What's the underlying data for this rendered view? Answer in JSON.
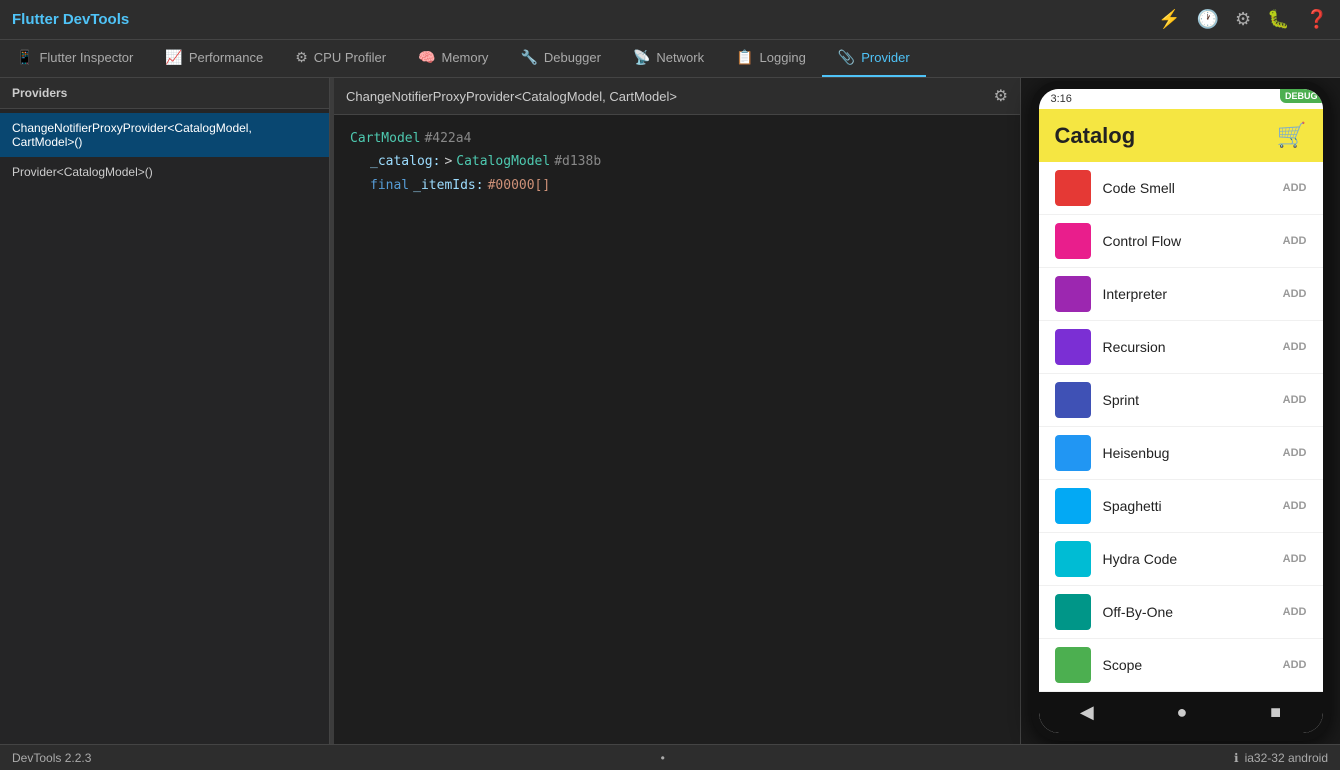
{
  "app": {
    "title": "Flutter DevTools"
  },
  "tabs": [
    {
      "id": "flutter-inspector",
      "label": "Flutter Inspector",
      "icon": "📱",
      "active": false
    },
    {
      "id": "performance",
      "label": "Performance",
      "icon": "📈",
      "active": false
    },
    {
      "id": "cpu-profiler",
      "label": "CPU Profiler",
      "icon": "⚙",
      "active": false
    },
    {
      "id": "memory",
      "label": "Memory",
      "icon": "🧠",
      "active": false
    },
    {
      "id": "debugger",
      "label": "Debugger",
      "icon": "🔧",
      "active": false
    },
    {
      "id": "network",
      "label": "Network",
      "icon": "📡",
      "active": false
    },
    {
      "id": "logging",
      "label": "Logging",
      "icon": "📋",
      "active": false
    },
    {
      "id": "provider",
      "label": "Provider",
      "icon": "📎",
      "active": true
    }
  ],
  "topbar_icons": {
    "lightning": "⚡",
    "history": "🕐",
    "settings": "⚙",
    "bug": "🐛",
    "help": "❓"
  },
  "providers_panel": {
    "header": "Providers",
    "items": [
      {
        "label": "ChangeNotifierProxyProvider<CatalogModel, CartModel>()",
        "selected": true
      },
      {
        "label": "Provider<CatalogModel>()",
        "selected": false
      }
    ]
  },
  "detail_panel": {
    "header": "ChangeNotifierProxyProvider<CatalogModel, CartModel>",
    "code": {
      "line1_ref": "CartModel",
      "line1_hash": "#422a4",
      "line2_key": "_catalog:",
      "line2_arrow": ">",
      "line2_type": "CatalogModel",
      "line2_hash": "#d138b",
      "line3_modifier": "final",
      "line3_key": "_itemIds:",
      "line3_value": "#00000[]"
    }
  },
  "phone": {
    "status_time": "3:16",
    "app_title": "Catalog",
    "items": [
      {
        "name": "Code Smell",
        "color": "#e53935",
        "add": "ADD"
      },
      {
        "name": "Control Flow",
        "color": "#e91e8c",
        "add": "ADD"
      },
      {
        "name": "Interpreter",
        "color": "#9c27b0",
        "add": "ADD"
      },
      {
        "name": "Recursion",
        "color": "#7b2fd4",
        "add": "ADD"
      },
      {
        "name": "Sprint",
        "color": "#3f51b5",
        "add": "ADD"
      },
      {
        "name": "Heisenbug",
        "color": "#2196f3",
        "add": "ADD"
      },
      {
        "name": "Spaghetti",
        "color": "#03a9f4",
        "add": "ADD"
      },
      {
        "name": "Hydra Code",
        "color": "#00bcd4",
        "add": "ADD"
      },
      {
        "name": "Off-By-One",
        "color": "#009688",
        "add": "ADD"
      },
      {
        "name": "Scope",
        "color": "#4caf50",
        "add": "ADD"
      }
    ]
  },
  "statusbar": {
    "version": "DevTools 2.2.3",
    "dot": "•",
    "info_icon": "ℹ",
    "device": "ia32-32 android"
  }
}
